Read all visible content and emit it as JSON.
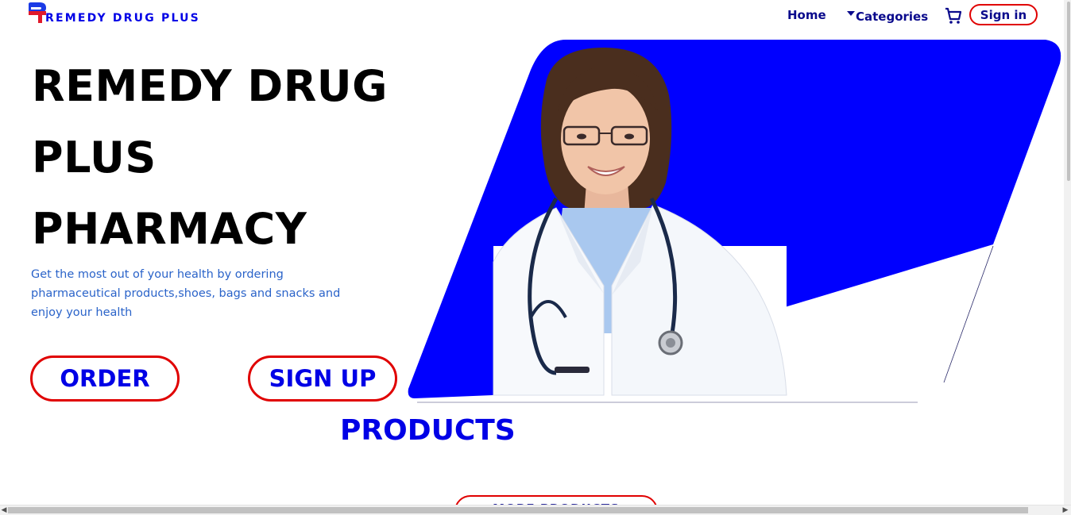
{
  "brand": {
    "name": "REMEDY DRUG PLUS",
    "logo_colors": {
      "blue": "#1a3ae6",
      "red": "#e01a2b"
    }
  },
  "nav": {
    "home": "Home",
    "categories": "Categories",
    "cart_icon": "cart-icon",
    "signin": "Sign in"
  },
  "hero": {
    "title_lines": [
      "REMEDY DRUG",
      "PLUS",
      "PHARMACY"
    ],
    "subtitle": "Get the most out of your health by ordering pharmaceutical products,shoes, bags and snacks and enjoy your health",
    "order_button": "ORDER",
    "signup_button": "SIGN UP",
    "image": "doctor-portrait",
    "accent": "#0000ff"
  },
  "products": {
    "heading": "PRODUCTS",
    "more_button": "MORE PRODUCTS"
  },
  "colors": {
    "primary_blue": "#0000e6",
    "nav_text": "#0a0a8c",
    "pill_border": "#e00000",
    "subtitle_text": "#2a63c9"
  }
}
